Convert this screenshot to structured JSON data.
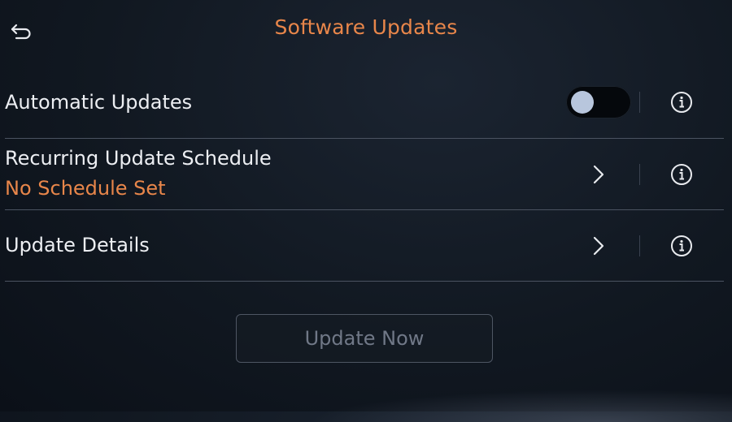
{
  "header": {
    "title": "Software Updates",
    "back_icon": "back-arrow-icon"
  },
  "colors": {
    "accent": "#e8864a",
    "background": "#111821",
    "divider": "#4b5361",
    "disabled_text": "#707887"
  },
  "rows": [
    {
      "label": "Automatic Updates",
      "control": "toggle",
      "toggle_on": false,
      "info_icon": "info-icon"
    },
    {
      "label": "Recurring Update Schedule",
      "sublabel": "No Schedule Set",
      "control": "chevron",
      "info_icon": "info-icon"
    },
    {
      "label": "Update Details",
      "control": "chevron",
      "info_icon": "info-icon"
    }
  ],
  "actions": {
    "update_now_label": "Update Now",
    "update_now_enabled": false
  }
}
